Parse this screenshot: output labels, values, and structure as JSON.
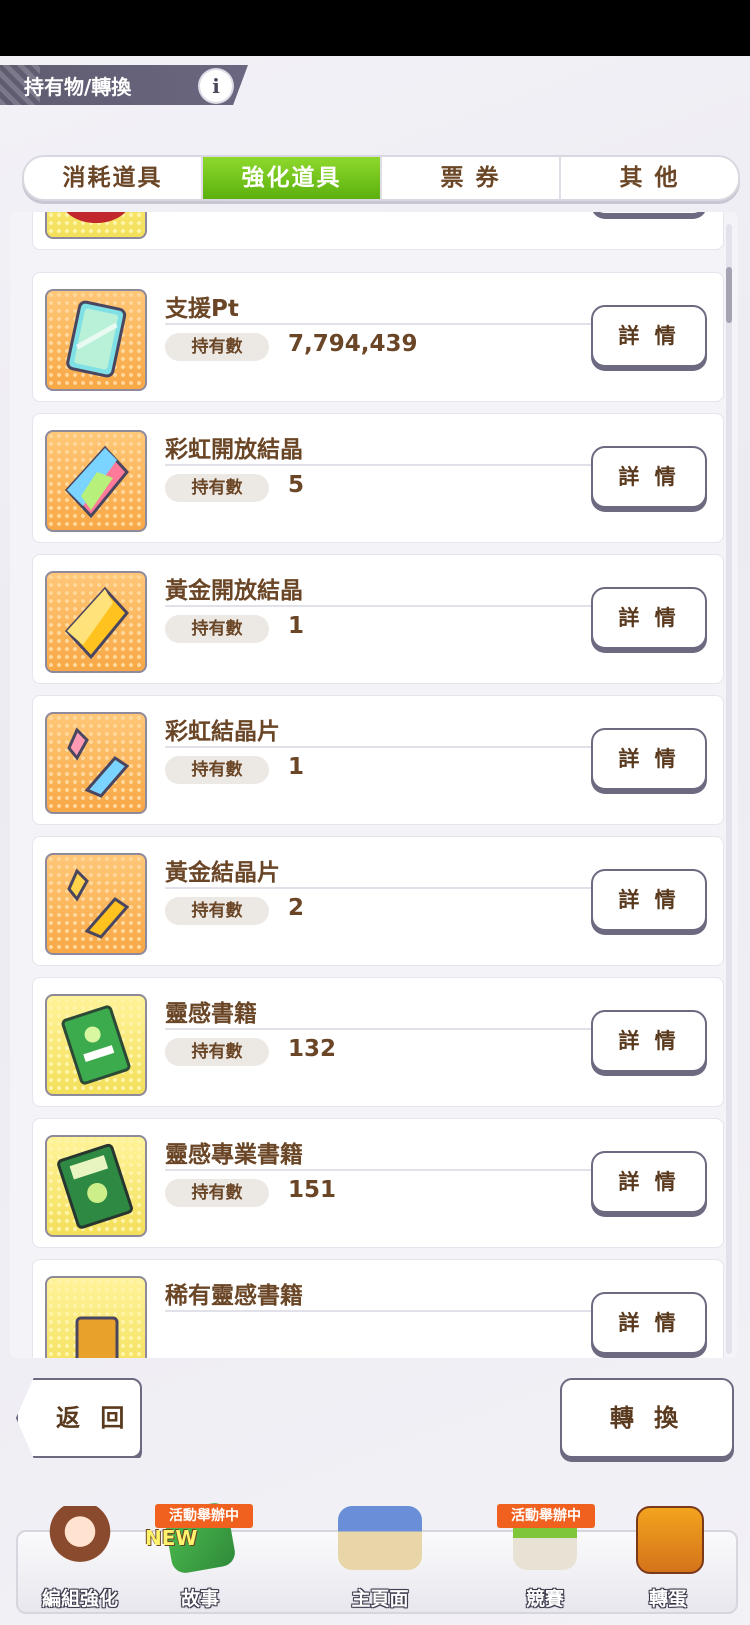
{
  "header": {
    "title": "持有物/轉換",
    "info_glyph": "i"
  },
  "tabs": [
    {
      "label": "消耗道具",
      "active": false
    },
    {
      "label": "強化道具",
      "active": true
    },
    {
      "label": "票 券",
      "active": false
    },
    {
      "label": "其 他",
      "active": false
    }
  ],
  "owned_label": "持有數",
  "detail_label": "詳 情",
  "items": [
    {
      "name": "支援Pt",
      "count": "7,794,439",
      "icon": "support-pt-card-icon"
    },
    {
      "name": "彩虹開放結晶",
      "count": "5",
      "icon": "rainbow-crystal-icon"
    },
    {
      "name": "黃金開放結晶",
      "count": "1",
      "icon": "gold-crystal-icon"
    },
    {
      "name": "彩虹結晶片",
      "count": "1",
      "icon": "rainbow-shard-icon"
    },
    {
      "name": "黃金結晶片",
      "count": "2",
      "icon": "gold-shard-icon"
    },
    {
      "name": "靈感書籍",
      "count": "132",
      "icon": "inspiration-book-icon"
    },
    {
      "name": "靈感專業書籍",
      "count": "151",
      "icon": "inspiration-pro-book-icon"
    },
    {
      "name": "稀有靈感書籍",
      "count": "",
      "icon": "rare-inspiration-book-icon"
    }
  ],
  "footer": {
    "back_label": "返 回",
    "convert_label": "轉 換"
  },
  "nav": {
    "event_badge": "活動舉辦中",
    "new_badge": "NEW",
    "items": [
      {
        "label": "編組強化"
      },
      {
        "label": "故事"
      },
      {
        "label": "主頁面"
      },
      {
        "label": "競賽"
      },
      {
        "label": "轉蛋"
      }
    ]
  },
  "colors": {
    "accent_green": "#6cc21a",
    "text_brown": "#6a4626",
    "event_orange": "#f0601e"
  }
}
